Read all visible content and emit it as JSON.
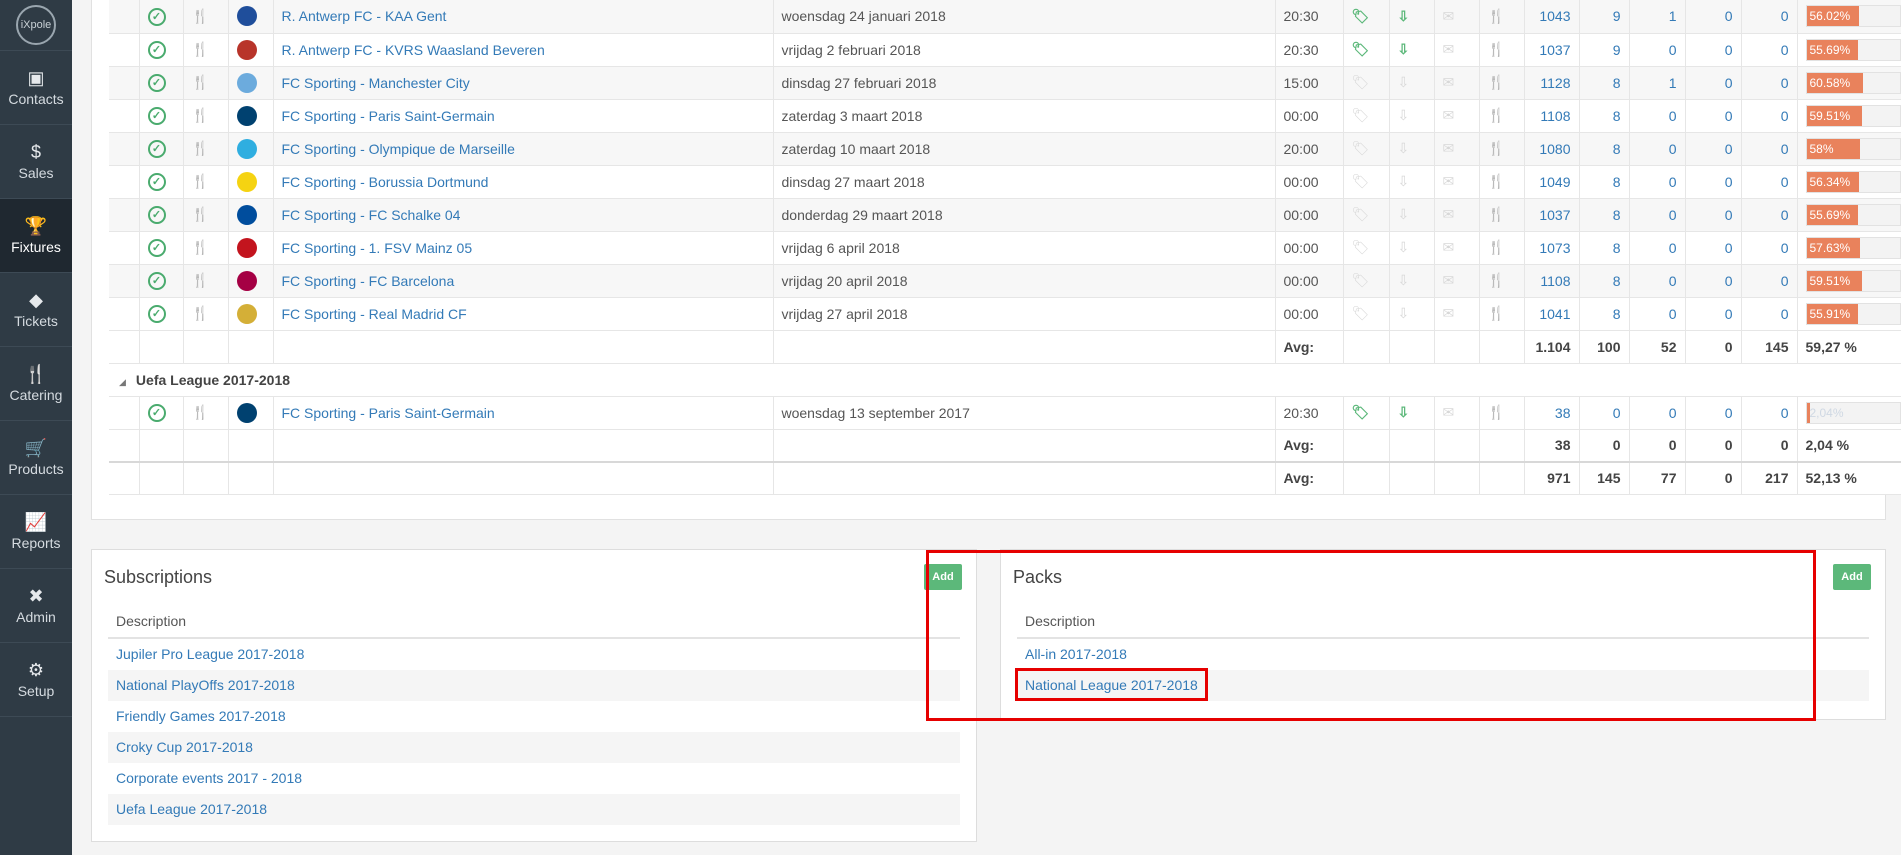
{
  "app": {
    "logo_text": "iXpole"
  },
  "sidebar": {
    "items": [
      {
        "label": "Contacts",
        "icon": "contacts-icon",
        "glyph": "▣"
      },
      {
        "label": "Sales",
        "icon": "dollar-icon",
        "glyph": "$"
      },
      {
        "label": "Fixtures",
        "icon": "trophy-icon",
        "glyph": "🏆"
      },
      {
        "label": "Tickets",
        "icon": "ticket-icon",
        "glyph": "◆"
      },
      {
        "label": "Catering",
        "icon": "cutlery-icon",
        "glyph": "🍴"
      },
      {
        "label": "Products",
        "icon": "cart-icon",
        "glyph": "🛒"
      },
      {
        "label": "Reports",
        "icon": "chart-icon",
        "glyph": "📈"
      },
      {
        "label": "Admin",
        "icon": "tools-icon",
        "glyph": "✖"
      },
      {
        "label": "Setup",
        "icon": "gears-icon",
        "glyph": "⚙"
      }
    ]
  },
  "fixtures": {
    "rows": [
      {
        "match": "R. Antwerp FC - KAA Gent",
        "date": "woensdag 24 januari 2018",
        "time": "20:30",
        "catering": true,
        "tags": true,
        "v1": "1043",
        "v2": "9",
        "v3": "1",
        "v4": "0",
        "v5": "0",
        "pct": "56.02%",
        "pct_value": 56.02,
        "crest_color": "#1f4e9b"
      },
      {
        "match": "R. Antwerp FC - KVRS Waasland Beveren",
        "date": "vrijdag 2 februari 2018",
        "time": "20:30",
        "catering": true,
        "tags": true,
        "v1": "1037",
        "v2": "9",
        "v3": "0",
        "v4": "0",
        "v5": "0",
        "pct": "55.69%",
        "pct_value": 55.69,
        "crest_color": "#b8342a"
      },
      {
        "match": "FC Sporting - Manchester City",
        "date": "dinsdag 27 februari 2018",
        "time": "15:00",
        "catering": false,
        "tags": false,
        "v1": "1128",
        "v2": "8",
        "v3": "1",
        "v4": "0",
        "v5": "0",
        "pct": "60.58%",
        "pct_value": 60.58,
        "crest_color": "#6cabdd"
      },
      {
        "match": "FC Sporting - Paris Saint-Germain",
        "date": "zaterdag 3 maart 2018",
        "time": "00:00",
        "catering": false,
        "tags": false,
        "v1": "1108",
        "v2": "8",
        "v3": "0",
        "v4": "0",
        "v5": "0",
        "pct": "59.51%",
        "pct_value": 59.51,
        "crest_color": "#004170"
      },
      {
        "match": "FC Sporting - Olympique de Marseille",
        "date": "zaterdag 10 maart 2018",
        "time": "20:00",
        "catering": false,
        "tags": false,
        "v1": "1080",
        "v2": "8",
        "v3": "0",
        "v4": "0",
        "v5": "0",
        "pct": "58%",
        "pct_value": 58,
        "crest_color": "#2faee0"
      },
      {
        "match": "FC Sporting - Borussia Dortmund",
        "date": "dinsdag 27 maart 2018",
        "time": "00:00",
        "catering": false,
        "tags": false,
        "v1": "1049",
        "v2": "8",
        "v3": "0",
        "v4": "0",
        "v5": "0",
        "pct": "56.34%",
        "pct_value": 56.34,
        "crest_color": "#f5d312"
      },
      {
        "match": "FC Sporting - FC Schalke 04",
        "date": "donderdag 29 maart 2018",
        "time": "00:00",
        "catering": false,
        "tags": false,
        "v1": "1037",
        "v2": "8",
        "v3": "0",
        "v4": "0",
        "v5": "0",
        "pct": "55.69%",
        "pct_value": 55.69,
        "crest_color": "#004d9d"
      },
      {
        "match": "FC Sporting - 1. FSV Mainz 05",
        "date": "vrijdag 6 april 2018",
        "time": "00:00",
        "catering": false,
        "tags": false,
        "v1": "1073",
        "v2": "8",
        "v3": "0",
        "v4": "0",
        "v5": "0",
        "pct": "57.63%",
        "pct_value": 57.63,
        "crest_color": "#c3141e"
      },
      {
        "match": "FC Sporting - FC Barcelona",
        "date": "vrijdag 20 april 2018",
        "time": "00:00",
        "catering": false,
        "tags": false,
        "v1": "1108",
        "v2": "8",
        "v3": "0",
        "v4": "0",
        "v5": "0",
        "pct": "59.51%",
        "pct_value": 59.51,
        "crest_color": "#a50044"
      },
      {
        "match": "FC Sporting - Real Madrid CF",
        "date": "vrijdag 27 april 2018",
        "time": "00:00",
        "catering": false,
        "tags": false,
        "v1": "1041",
        "v2": "8",
        "v3": "0",
        "v4": "0",
        "v5": "0",
        "pct": "55.91%",
        "pct_value": 55.91,
        "crest_color": "#d4af37"
      }
    ],
    "avg1": {
      "label": "Avg:",
      "v1": "1.104",
      "v2": "100",
      "v3": "52",
      "v4": "0",
      "v5": "145",
      "pct": "59,27 %"
    },
    "group2": {
      "label": "Uefa League 2017-2018"
    },
    "row2": {
      "match": "FC Sporting - Paris Saint-Germain",
      "date": "woensdag 13 september 2017",
      "time": "20:30",
      "v1": "38",
      "v2": "0",
      "v3": "0",
      "v4": "0",
      "v5": "0",
      "pct": "2,04%",
      "pct_value": 2.04,
      "crest_color": "#004170"
    },
    "avg2": {
      "label": "Avg:",
      "v1": "38",
      "v2": "0",
      "v3": "0",
      "v4": "0",
      "v5": "0",
      "pct": "2,04 %"
    },
    "total": {
      "label": "Avg:",
      "v1": "971",
      "v2": "145",
      "v3": "77",
      "v4": "0",
      "v5": "217",
      "pct": "52,13 %"
    }
  },
  "subscriptions": {
    "title": "Subscriptions",
    "add_label": "Add",
    "column_header": "Description",
    "items": [
      "Jupiler Pro League 2017-2018",
      "National PlayOffs 2017-2018",
      "Friendly Games 2017-2018",
      "Croky Cup 2017-2018",
      "Corporate events 2017 - 2018",
      "Uefa League 2017-2018"
    ]
  },
  "packs": {
    "title": "Packs",
    "add_label": "Add",
    "column_header": "Description",
    "items": [
      "All-in 2017-2018",
      "National League 2017-2018"
    ]
  },
  "colors": {
    "accent_green": "#5cb87a",
    "progress_orange": "#e9825c",
    "link_blue": "#337ab7",
    "highlight_red": "#e60000",
    "sidebar_bg": "#2f3b45"
  }
}
